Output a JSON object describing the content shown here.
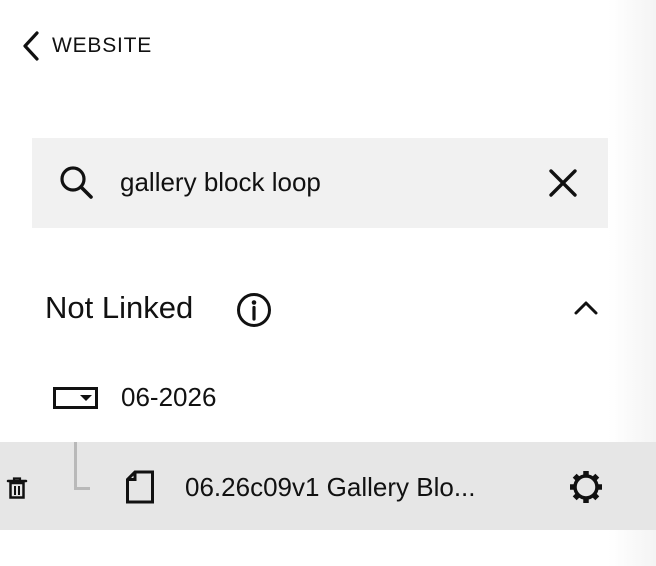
{
  "header": {
    "back_label": "WEBSITE"
  },
  "search": {
    "value": "gallery block loop"
  },
  "section": {
    "title": "Not Linked"
  },
  "tree": {
    "folder": {
      "label": "06-2026"
    },
    "page": {
      "label": "06.26c09v1 Gallery Blo..."
    }
  },
  "icons": {
    "back": "chevron-left-icon",
    "search": "search-icon",
    "clear": "close-icon",
    "info": "info-icon",
    "collapse": "chevron-up-icon",
    "folder": "folder-dropdown-icon",
    "trash": "trash-icon",
    "page": "page-icon",
    "settings": "gear-icon"
  },
  "colors": {
    "search_bg": "#f1f1f1",
    "selected_row_bg": "#e6e6e6",
    "text": "#111111",
    "connector": "#b9b9b9"
  }
}
